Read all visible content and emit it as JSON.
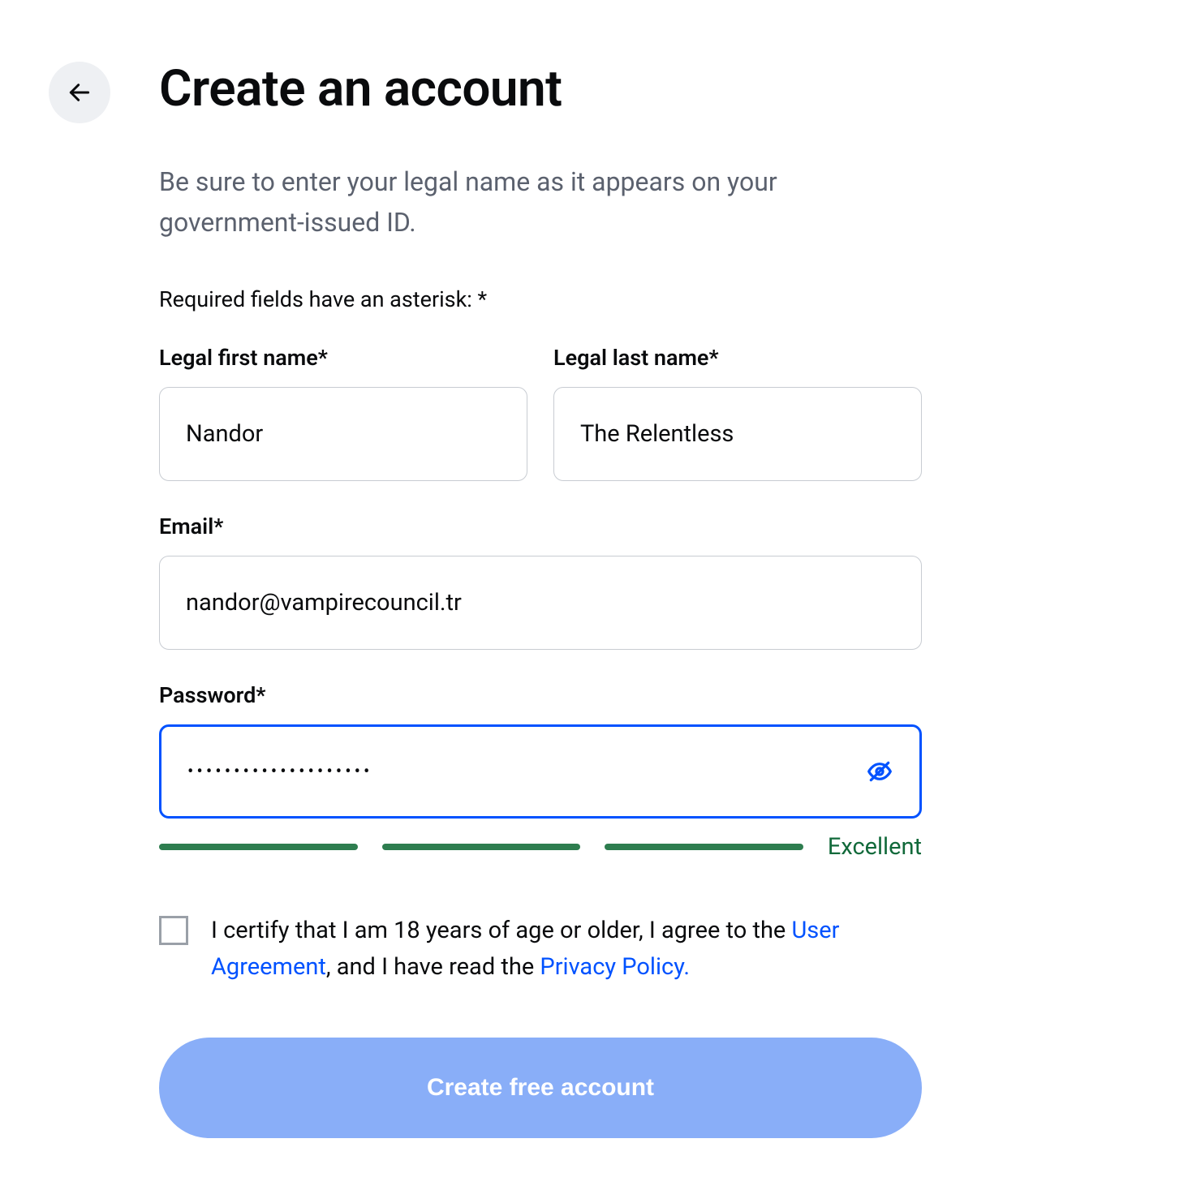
{
  "header": {
    "title": "Create an account",
    "subtitle": "Be sure to enter your legal name as it appears on your government-issued ID.",
    "required_note": "Required fields have an asterisk: *"
  },
  "form": {
    "first_name": {
      "label": "Legal first name*",
      "value": "Nandor"
    },
    "last_name": {
      "label": "Legal last name*",
      "value": "The Relentless"
    },
    "email": {
      "label": "Email*",
      "value": "nandor@vampirecouncil.tr"
    },
    "password": {
      "label": "Password*",
      "value": "••••••••••••••••••••",
      "strength_label": "Excellent",
      "strength_bars_filled": 3,
      "strength_color": "#2e7d4f"
    }
  },
  "certify": {
    "prefix": "I certify that I am 18 years of age or older, I agree to the ",
    "link1": "User Agreement",
    "middle": ", and I have read the ",
    "link2": "Privacy Policy."
  },
  "submit_label": "Create free account"
}
